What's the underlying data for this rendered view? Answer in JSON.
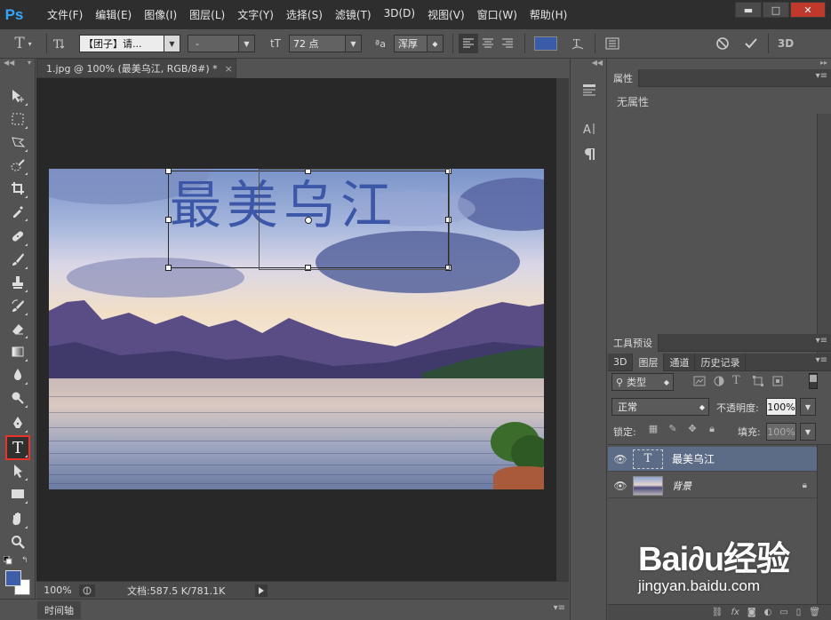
{
  "app": {
    "logo": "Ps",
    "menu": [
      "文件(F)",
      "编辑(E)",
      "图像(I)",
      "图层(L)",
      "文字(Y)",
      "选择(S)",
      "滤镜(T)",
      "3D(D)",
      "视图(V)",
      "窗口(W)",
      "帮助(H)"
    ],
    "window_controls": {
      "minimize": "▬",
      "maximize": "□",
      "close": "✕"
    }
  },
  "options": {
    "font_family": "【团子】请...",
    "font_style": "-",
    "font_size": "72 点",
    "antialias": "浑厚",
    "text_color": "#3a5ca8",
    "font_size_icon": "tT",
    "aa_icon": "ªa"
  },
  "document": {
    "tab_title": "1.jpg @ 100% (最美乌江, RGB/8#) *",
    "close": "×",
    "canvas_text": "最美乌江",
    "text_color": "#3d57a8",
    "zoom": "100%",
    "doc_info": "文档:587.5 K/781.1K"
  },
  "timeline": {
    "label": "时间轴"
  },
  "toolbar": {
    "fg_color": "#3f5ea8",
    "bg_color": "#ffffff"
  },
  "properties": {
    "tab": "属性",
    "content": "无属性"
  },
  "tool_presets": {
    "tab": "工具预设"
  },
  "layers_panel": {
    "tabs": [
      "3D",
      "图层",
      "通道",
      "历史记录"
    ],
    "filter": "类型",
    "blend_mode": "正常",
    "opacity_label": "不透明度:",
    "opacity": "100%",
    "lock_label": "锁定:",
    "fill_label": "填充:",
    "fill": "100%",
    "layers": [
      {
        "name": "最美乌江",
        "type": "text",
        "selected": true,
        "thumb": "T"
      },
      {
        "name": "背景",
        "type": "image",
        "selected": false
      }
    ]
  },
  "watermark": {
    "logo": "Bai∂u经验",
    "url": "jingyan.baidu.com"
  }
}
